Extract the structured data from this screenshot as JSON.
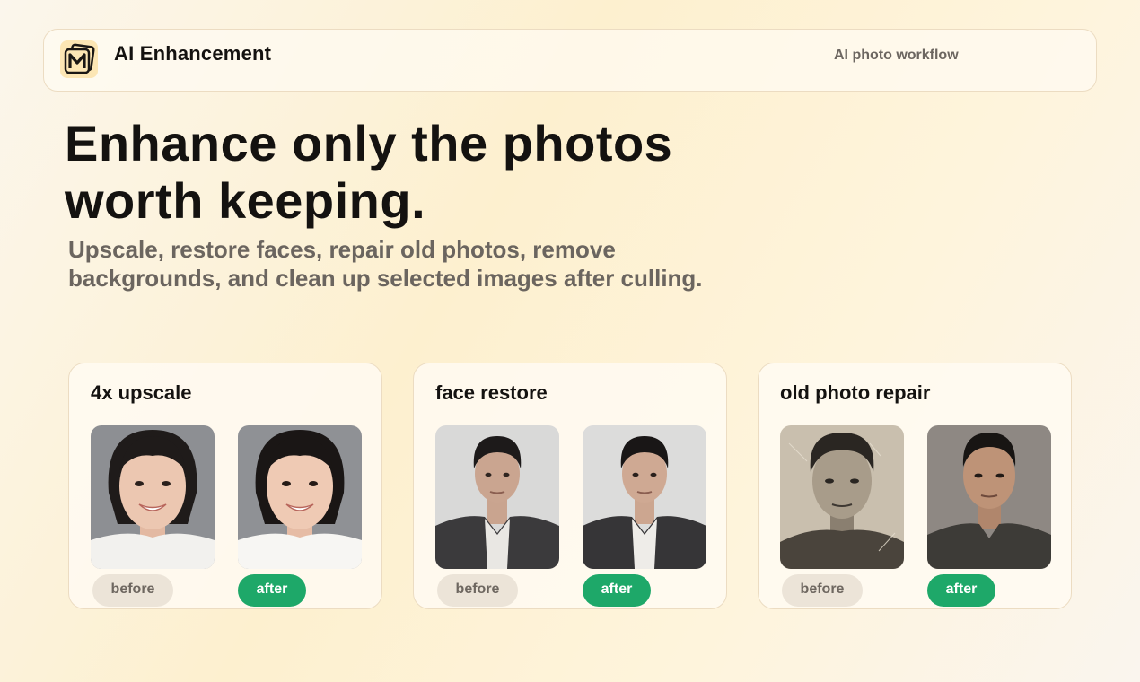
{
  "header": {
    "brand": "AI Enhancement",
    "tagline": "AI photo workflow",
    "logo_icon": "m-logo-icon"
  },
  "hero": {
    "title": "Enhance only the photos worth keeping.",
    "subtitle": "Upscale, restore faces, repair old photos, remove backgrounds, and clean up selected images after culling."
  },
  "cards": [
    {
      "title": "4x upscale",
      "before_label": "before",
      "after_label": "after"
    },
    {
      "title": "face restore",
      "before_label": "before",
      "after_label": "after"
    },
    {
      "title": "old photo repair",
      "before_label": "before",
      "after_label": "after"
    }
  ],
  "colors": {
    "accent_green": "#1ea869",
    "before_badge": "#ece4d8",
    "logo_bg": "#fce6b4"
  }
}
